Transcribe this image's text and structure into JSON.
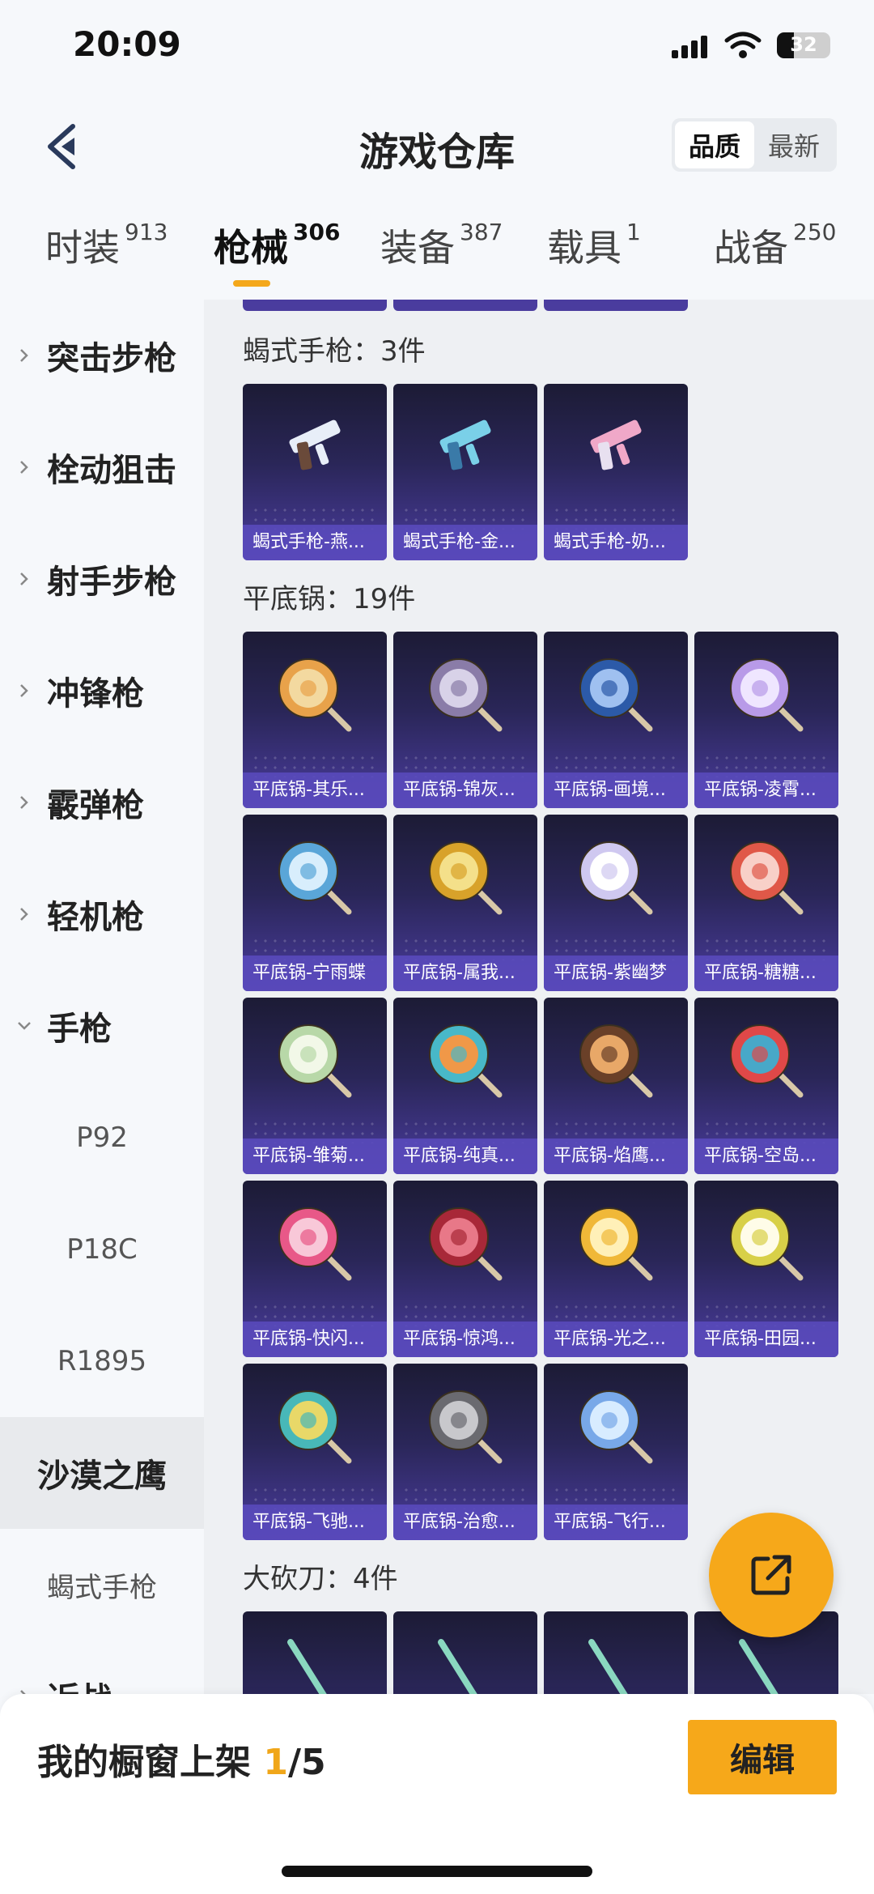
{
  "status_bar": {
    "time": "20:09",
    "battery": "32"
  },
  "header": {
    "title": "游戏仓库",
    "sort_options": [
      "品质",
      "最新"
    ],
    "sort_active": 0
  },
  "tabs": [
    {
      "label": "时装",
      "count": "913"
    },
    {
      "label": "枪械",
      "count": "306"
    },
    {
      "label": "装备",
      "count": "387"
    },
    {
      "label": "载具",
      "count": "1"
    },
    {
      "label": "战备",
      "count": "250"
    }
  ],
  "sidebar": {
    "categories": [
      "突击步枪",
      "栓动狙击",
      "射手步枪",
      "冲锋枪",
      "霰弹枪",
      "轻机枪",
      "手枪"
    ],
    "pistol_sub": [
      "P92",
      "P18C",
      "R1895",
      "沙漠之鹰",
      "蝎式手枪"
    ],
    "selected": "沙漠之鹰",
    "partial_next": "近战"
  },
  "sections": [
    {
      "title": "蝎式手枪：3件",
      "items": [
        "蝎式手枪-燕...",
        "蝎式手枪-金...",
        "蝎式手枪-奶..."
      ]
    },
    {
      "title": "平底锅：19件",
      "items": [
        "平底锅-其乐...",
        "平底锅-锦灰...",
        "平底锅-画境...",
        "平底锅-凌霄...",
        "平底锅-宁雨蝶",
        "平底锅-属我...",
        "平底锅-紫幽梦",
        "平底锅-糖糖...",
        "平底锅-雏菊...",
        "平底锅-纯真...",
        "平底锅-焰鹰...",
        "平底锅-空岛...",
        "平底锅-快闪...",
        "平底锅-惊鸿...",
        "平底锅-光之...",
        "平底锅-田园...",
        "平底锅-飞驰...",
        "平底锅-治愈...",
        "平底锅-飞行..."
      ]
    },
    {
      "title": "大砍刀：4件"
    }
  ],
  "bottom_bar": {
    "label": "我的橱窗上架",
    "count": "1",
    "total": "/5",
    "edit_label": "编辑"
  },
  "colors": {
    "accent": "#f6a81a",
    "card_bottom": "#4a3c9e",
    "card_top": "#1c1b35"
  },
  "icons": [
    "back-icon",
    "signal-icon",
    "wifi-icon",
    "battery-icon",
    "share-icon",
    "chevron-right-icon",
    "chevron-down-icon"
  ]
}
